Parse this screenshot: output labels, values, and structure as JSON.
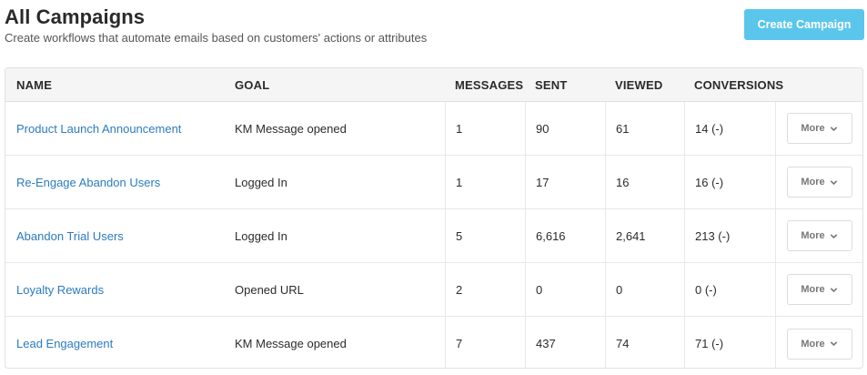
{
  "header": {
    "title": "All Campaigns",
    "subtitle": "Create workflows that automate emails based on customers' actions or attributes",
    "create_button_label": "Create Campaign"
  },
  "colors": {
    "accent": "#5bc6ec",
    "link": "#2b7bbf"
  },
  "table": {
    "columns": {
      "name": "NAME",
      "goal": "GOAL",
      "messages": "MESSAGES",
      "sent": "SENT",
      "viewed": "VIEWED",
      "conversions": "CONVERSIONS"
    },
    "rows": [
      {
        "name": "Product Launch Announcement",
        "goal": "KM Message opened",
        "messages": "1",
        "sent": "90",
        "viewed": "61",
        "conversions": "14 (-)",
        "more": "More"
      },
      {
        "name": "Re-Engage Abandon Users",
        "goal": "Logged In",
        "messages": "1",
        "sent": "17",
        "viewed": "16",
        "conversions": "16 (-)",
        "more": "More"
      },
      {
        "name": "Abandon Trial Users",
        "goal": "Logged In",
        "messages": "5",
        "sent": "6,616",
        "viewed": "2,641",
        "conversions": "213 (-)",
        "more": "More"
      },
      {
        "name": "Loyalty Rewards",
        "goal": "Opened URL",
        "messages": "2",
        "sent": "0",
        "viewed": "0",
        "conversions": "0 (-)",
        "more": "More"
      },
      {
        "name": "Lead Engagement",
        "goal": "KM Message opened",
        "messages": "7",
        "sent": "437",
        "viewed": "74",
        "conversions": "71 (-)",
        "more": "More"
      }
    ]
  }
}
